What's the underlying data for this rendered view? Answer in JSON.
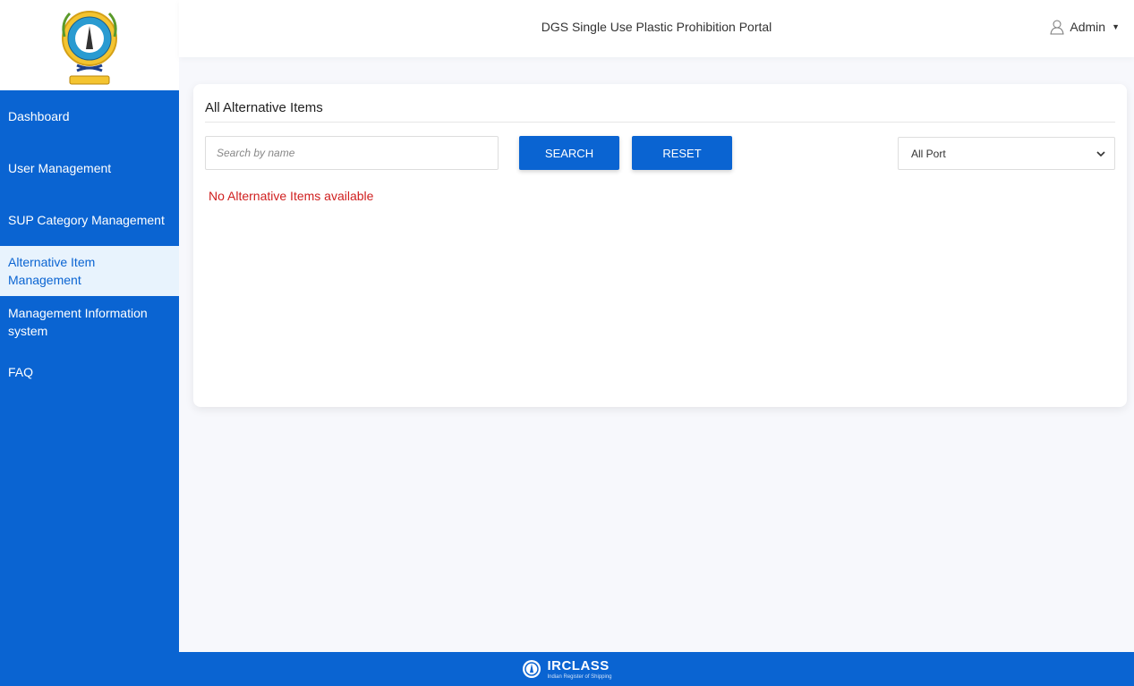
{
  "header": {
    "title": "DGS Single Use Plastic Prohibition Portal",
    "user_label": "Admin"
  },
  "sidebar": {
    "items": [
      {
        "label": "Dashboard"
      },
      {
        "label": "User Management"
      },
      {
        "label": "SUP Category Management"
      },
      {
        "label": "Alternative Item Management",
        "active": true
      },
      {
        "label": "Management Information system"
      },
      {
        "label": "FAQ"
      }
    ]
  },
  "main": {
    "title": "All Alternative Items",
    "search": {
      "placeholder": "Search by name",
      "value": ""
    },
    "search_button": "SEARCH",
    "reset_button": "RESET",
    "port_filter": {
      "selected": "All Port"
    },
    "empty_message": "No Alternative Items available"
  },
  "footer": {
    "brand": "IRCLASS",
    "tagline": "Indian Register of Shipping"
  },
  "colors": {
    "primary": "#0a64d2",
    "active_bg": "#e8f3fd",
    "error": "#d02020"
  },
  "icons": {
    "user": "user-icon",
    "caret": "caret-down-icon",
    "chevron": "chevron-down-icon",
    "logo": "dgs-emblem-logo",
    "footer_logo": "irclass-logo"
  }
}
